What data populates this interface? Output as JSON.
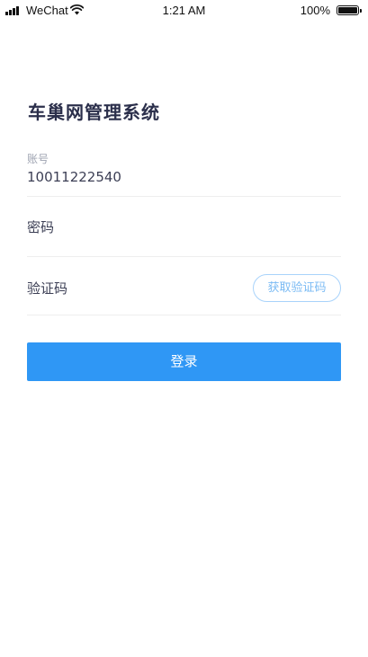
{
  "status_bar": {
    "carrier": "WeChat",
    "time": "1:21 AM",
    "battery": "100%"
  },
  "login": {
    "title": "车巢网管理系统",
    "account_label": "账号",
    "account_value": "10011222540",
    "password_label": "密码",
    "code_label": "验证码",
    "get_code_button": "获取验证码",
    "login_button": "登录"
  },
  "colors": {
    "primary": "#2f97f5",
    "title": "#2b2f4b",
    "code_button_border": "#a8d3fb"
  },
  "icons": [
    "signal-icon",
    "wifi-icon",
    "battery-icon"
  ]
}
